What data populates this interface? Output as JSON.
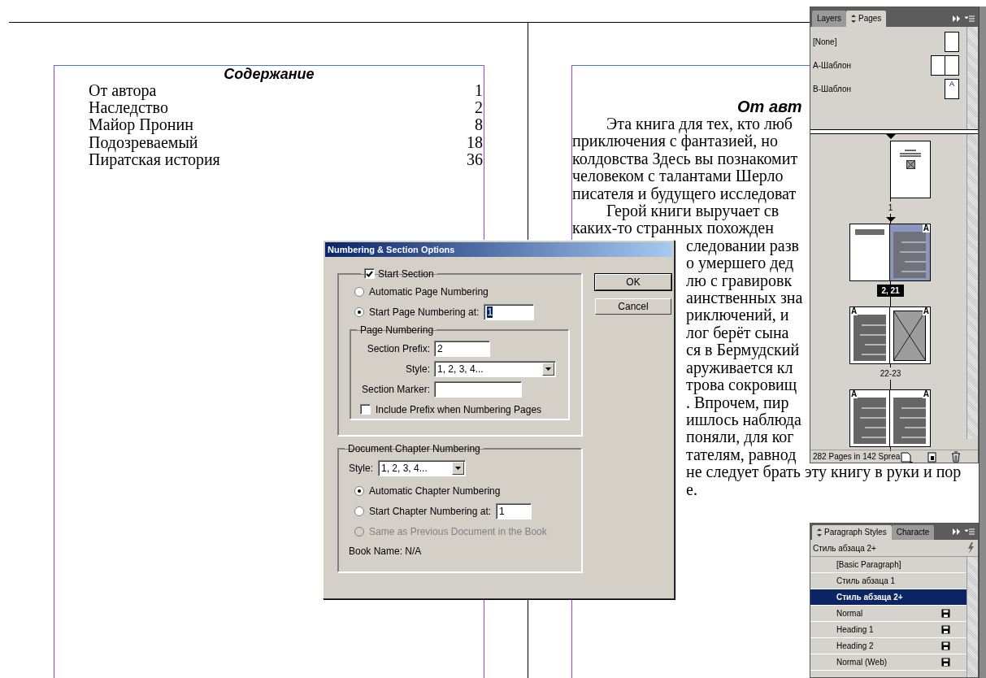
{
  "left_page": {
    "title": "Содержание",
    "toc": [
      {
        "entry": "От автора",
        "page": "1"
      },
      {
        "entry": "Наследство",
        "page": "2"
      },
      {
        "entry": "Майор Пронин",
        "page": "8"
      },
      {
        "entry": "Подозреваемый",
        "page": "18"
      },
      {
        "entry": "Пиратская история",
        "page": "36"
      }
    ]
  },
  "right_page": {
    "title": "От авт",
    "lines": [
      {
        "text": "Эта книга для тех, кто люб",
        "kind": "indent"
      },
      {
        "text": "приключения с фантазией, но",
        "kind": "plain"
      },
      {
        "text": "колдовства Здесь вы познакомит",
        "kind": "plain"
      },
      {
        "text": "человеком с талантами Шерло",
        "kind": "plain"
      },
      {
        "text": "писателя и будущего исследоват",
        "kind": "plain"
      },
      {
        "text": "Герой книги выручает св",
        "kind": "indent"
      },
      {
        "text": "каких-то странных похожден",
        "kind": "plain"
      },
      {
        "text": "следовании разв",
        "kind": "after-dialog"
      },
      {
        "text": "о умершего дед",
        "kind": "after-dialog"
      },
      {
        "text": "лю с гравировк",
        "kind": "after-dialog"
      },
      {
        "text": "аинственных зна",
        "kind": "after-dialog"
      },
      {
        "text": "риключений, и",
        "kind": "after-dialog"
      },
      {
        "text": "лог берёт сына",
        "kind": "after-dialog"
      },
      {
        "text": "ся в Бермудский",
        "kind": "after-dialog"
      },
      {
        "text": "аруживается кл",
        "kind": "after-dialog"
      },
      {
        "text": "трова сокровищ",
        "kind": "after-dialog"
      },
      {
        "text": ". Впрочем, пир",
        "kind": "after-dialog"
      },
      {
        "text": "ишлось наблюда",
        "kind": "after-dialog"
      },
      {
        "text": "поняли, для ког",
        "kind": "after-dialog"
      },
      {
        "text": "тателям, равнод",
        "kind": "after-dialog"
      },
      {
        "text": "не следует брать эту книгу в руки и пор",
        "kind": "after-dialog"
      },
      {
        "text": "е.",
        "kind": "after-dialog"
      }
    ]
  },
  "dialog": {
    "title": "Numbering & Section Options",
    "start_section": {
      "label": "Start Section",
      "checked": true
    },
    "page_options": [
      {
        "label": "Automatic Page Numbering",
        "selected": false
      },
      {
        "label": "Start Page Numbering at:",
        "selected": true,
        "value": "1",
        "text_selected": true
      }
    ],
    "page_numbering": {
      "title": "Page Numbering",
      "fields": [
        {
          "label": "Section Prefix:",
          "value": "2",
          "kind": "text"
        },
        {
          "label": "Style:",
          "value": "1, 2, 3, 4...",
          "kind": "dropdown"
        },
        {
          "label": "Section Marker:",
          "kind": "text"
        }
      ],
      "include_prefix": {
        "label": "Include Prefix when Numbering Pages",
        "checked": false
      }
    },
    "chapter": {
      "title": "Document Chapter Numbering",
      "style": {
        "label": "Style:",
        "value": "1, 2, 3, 4..."
      },
      "options": [
        {
          "label": "Automatic Chapter Numbering",
          "selected": true,
          "disabled": false
        },
        {
          "label": "Start Chapter Numbering at:",
          "selected": false,
          "disabled": false,
          "value": "1"
        },
        {
          "label": "Same as Previous Document in the Book",
          "selected": false,
          "disabled": true
        }
      ],
      "book_name": "Book Name: N/A"
    },
    "buttons": [
      {
        "label": "OK",
        "default": true
      },
      {
        "label": "Cancel",
        "default": false
      }
    ]
  },
  "pages_panel": {
    "tabs": [
      {
        "label": "Layers",
        "selected": false
      },
      {
        "label": "Pages",
        "selected": true
      }
    ],
    "masters": [
      {
        "label": "[None]",
        "kind": "single"
      },
      {
        "label": "A-Шаблон",
        "kind": "spread"
      },
      {
        "label": "B-Шаблон",
        "kind": "single",
        "master": "A"
      }
    ],
    "spreads": [
      {
        "label": "1",
        "selected": false,
        "section_start": true,
        "kind": "right-only",
        "pages": [
          {
            "kind": "title",
            "selected": false
          }
        ]
      },
      {
        "label": "2, 21",
        "selected": true,
        "section_start": true,
        "kind": "pair",
        "pages": [
          {
            "kind": "heading",
            "selected": false
          },
          {
            "kind": "text",
            "selected": true,
            "master": "A"
          }
        ]
      },
      {
        "label": "22-23",
        "selected": false,
        "section_start": false,
        "kind": "pair",
        "pages": [
          {
            "kind": "text",
            "selected": false,
            "master": "A"
          },
          {
            "kind": "image",
            "selected": false,
            "master": "A"
          }
        ]
      },
      {
        "selected": false,
        "section_start": false,
        "kind": "pair",
        "pages": [
          {
            "kind": "text",
            "selected": false,
            "master": "A"
          },
          {
            "kind": "text",
            "selected": false,
            "master": "A"
          }
        ]
      }
    ],
    "footer": "282 Pages in 142 Sprea"
  },
  "styles_panel": {
    "tabs": [
      {
        "label": "Paragraph Styles",
        "selected": true
      },
      {
        "label": "Characte",
        "selected": false
      }
    ],
    "current": "Стиль абзаца 2+",
    "items": [
      {
        "label": "[Basic Paragraph]",
        "selected": false,
        "kind": "native"
      },
      {
        "label": "Стиль абзаца 1",
        "selected": false,
        "kind": "native"
      },
      {
        "label": "Стиль абзаца 2+",
        "selected": true,
        "kind": "native"
      },
      {
        "label": "Normal",
        "selected": false,
        "kind": "imported"
      },
      {
        "label": "Heading 1",
        "selected": false,
        "kind": "imported"
      },
      {
        "label": "Heading 2",
        "selected": false,
        "kind": "imported"
      },
      {
        "label": "Normal (Web)",
        "selected": false,
        "kind": "imported"
      }
    ]
  }
}
